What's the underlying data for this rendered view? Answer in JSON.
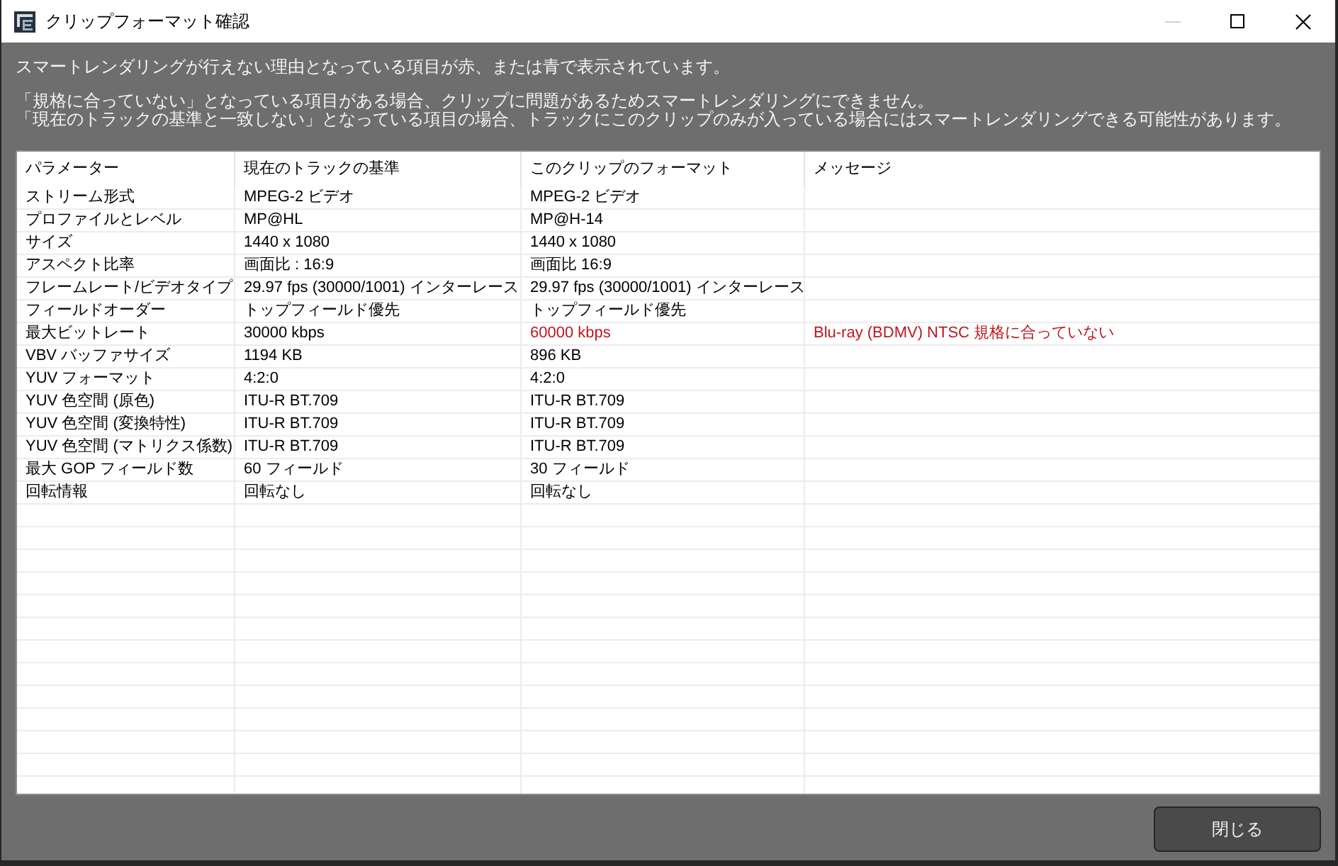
{
  "window": {
    "title": "クリップフォーマット確認",
    "controls": [
      {
        "kind": "minimize",
        "disabled": true
      },
      {
        "kind": "maximize",
        "disabled": false
      },
      {
        "kind": "close",
        "disabled": false
      }
    ]
  },
  "notes": [
    {
      "lines": [
        "スマートレンダリングが行えない理由となっている項目が赤、または青で表示されています。"
      ]
    },
    {
      "lines": [
        "「規格に合っていない」となっている項目がある場合、クリップに問題があるためスマートレンダリングにできません。",
        "「現在のトラックの基準と一致しない」となっている項目の場合、トラックにこのクリップのみが入っている場合にはスマートレンダリングできる可能性があります。"
      ]
    }
  ],
  "table": {
    "columns": [
      "パラメーター",
      "現在のトラックの基準",
      "このクリップのフォーマット",
      "メッセージ"
    ],
    "rows": [
      {
        "parameter": "ストリーム形式",
        "current": "MPEG-2 ビデオ",
        "clip": "MPEG-2 ビデオ",
        "out_of_spec": false
      },
      {
        "parameter": "プロファイルとレベル",
        "current": "MP@HL",
        "clip": "MP@H-14",
        "out_of_spec": false
      },
      {
        "parameter": "サイズ",
        "current": "1440 x 1080",
        "clip": "1440 x 1080",
        "out_of_spec": false
      },
      {
        "parameter": "アスペクト比率",
        "current": "画面比 : 16:9",
        "clip": "画面比 16:9",
        "out_of_spec": false
      },
      {
        "parameter": "フレームレート/ビデオタイプ",
        "current": "29.97 fps (30000/1001) インターレース",
        "clip": "29.97 fps (30000/1001) インターレース",
        "out_of_spec": false
      },
      {
        "parameter": "フィールドオーダー",
        "current": "トップフィールド優先",
        "clip": "トップフィールド優先",
        "out_of_spec": false
      },
      {
        "parameter": "最大ビットレート",
        "current": "30000 kbps",
        "clip": "60000 kbps",
        "message": "Blu-ray (BDMV) NTSC 規格に合っていない",
        "out_of_spec": true
      },
      {
        "parameter": "VBV バッファサイズ",
        "current": "1194 KB",
        "clip": "896 KB",
        "out_of_spec": false
      },
      {
        "parameter": "YUV フォーマット",
        "current": "4:2:0",
        "clip": "4:2:0",
        "out_of_spec": false
      },
      {
        "parameter": "YUV 色空間 (原色)",
        "current": "ITU-R BT.709",
        "clip": "ITU-R BT.709",
        "out_of_spec": false
      },
      {
        "parameter": "YUV 色空間 (変換特性)",
        "current": "ITU-R BT.709",
        "clip": "ITU-R BT.709",
        "out_of_spec": false
      },
      {
        "parameter": "YUV 色空間 (マトリクス係数)",
        "current": "ITU-R BT.709",
        "clip": "ITU-R BT.709",
        "out_of_spec": false
      },
      {
        "parameter": "最大 GOP フィールド数",
        "current": "60 フィールド",
        "clip": "30 フィールド",
        "out_of_spec": false
      },
      {
        "parameter": "回転情報",
        "current": "回転なし",
        "clip": "回転なし",
        "out_of_spec": false
      }
    ]
  },
  "buttons": [
    {
      "label": "閉じる"
    }
  ]
}
